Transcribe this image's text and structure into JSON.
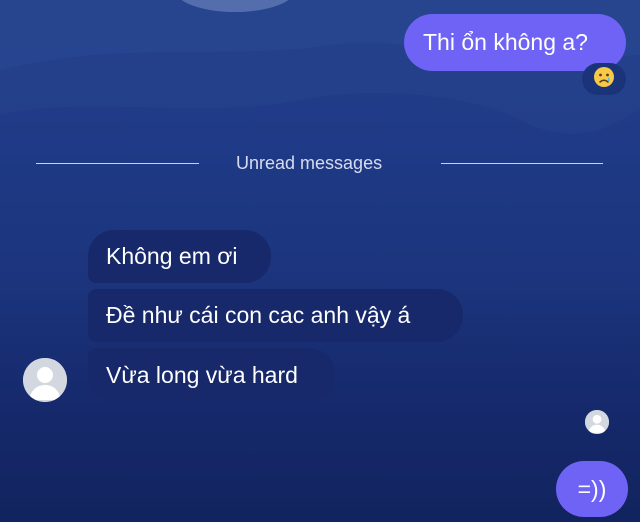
{
  "messages": {
    "outgoing_top": {
      "text": "Thi ổn không a?"
    },
    "reaction": {
      "emoji": "😢",
      "icon": "crying-face-icon"
    },
    "divider": {
      "label": "Unread messages"
    },
    "incoming": [
      {
        "text": "Không em ơi"
      },
      {
        "text": "Đề như cái con cac anh vậy á"
      },
      {
        "text": "Vừa long vừa hard"
      }
    ],
    "outgoing_bottom": {
      "text": "=))"
    }
  },
  "colors": {
    "outgoing_bubble": "#6f63f6",
    "incoming_bubble": "#17296a",
    "background_top": "#233f8a",
    "background_bottom": "#12245f"
  }
}
